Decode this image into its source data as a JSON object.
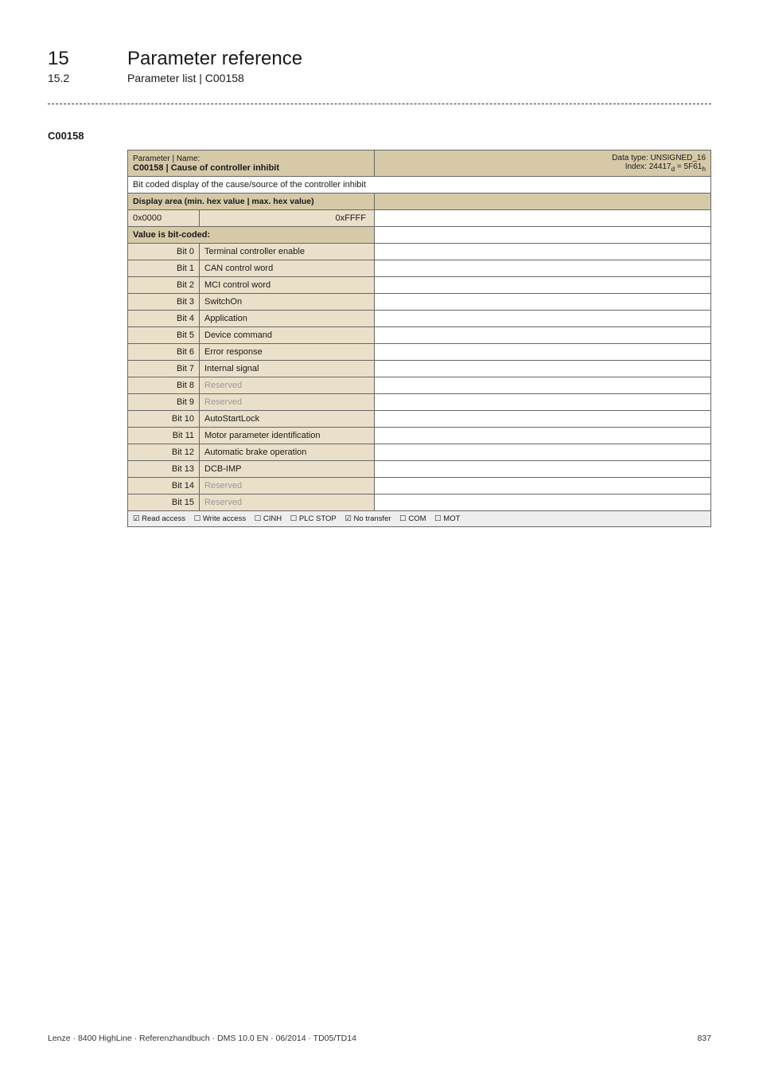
{
  "chapter": {
    "num": "15",
    "title": "Parameter reference"
  },
  "sub": {
    "num": "15.2",
    "title": "Parameter list | C00158"
  },
  "param_code": "C00158",
  "table": {
    "header": {
      "pname_label": "Parameter | Name:",
      "pname_main": "C00158 | Cause of controller inhibit",
      "dtype1": "Data type: UNSIGNED_16",
      "dtype2": "Index: 24417d = 5F61h"
    },
    "desc": "Bit coded display of the cause/source of the controller inhibit",
    "display_area_label": "Display area (min. hex value | max. hex value)",
    "hex_min": "0x0000",
    "hex_max": "0xFFFF",
    "bitcoded_label": "Value is bit-coded:",
    "bits": [
      {
        "label": "Bit 0",
        "desc": "Terminal controller enable",
        "reserved": false
      },
      {
        "label": "Bit 1",
        "desc": "CAN control word",
        "reserved": false
      },
      {
        "label": "Bit 2",
        "desc": "MCI control word",
        "reserved": false
      },
      {
        "label": "Bit 3",
        "desc": "SwitchOn",
        "reserved": false
      },
      {
        "label": "Bit 4",
        "desc": "Application",
        "reserved": false
      },
      {
        "label": "Bit 5",
        "desc": "Device command",
        "reserved": false
      },
      {
        "label": "Bit 6",
        "desc": "Error response",
        "reserved": false
      },
      {
        "label": "Bit 7",
        "desc": "Internal signal",
        "reserved": false
      },
      {
        "label": "Bit 8",
        "desc": "Reserved",
        "reserved": true
      },
      {
        "label": "Bit 9",
        "desc": "Reserved",
        "reserved": true
      },
      {
        "label": "Bit 10",
        "desc": "AutoStartLock",
        "reserved": false
      },
      {
        "label": "Bit 11",
        "desc": "Motor parameter identification",
        "reserved": false
      },
      {
        "label": "Bit 12",
        "desc": "Automatic brake operation",
        "reserved": false
      },
      {
        "label": "Bit 13",
        "desc": "DCB-IMP",
        "reserved": false
      },
      {
        "label": "Bit 14",
        "desc": "Reserved",
        "reserved": true
      },
      {
        "label": "Bit 15",
        "desc": "Reserved",
        "reserved": true
      }
    ],
    "access": {
      "read": "☑ Read access",
      "write": "☐ Write access",
      "cinh": "☐ CINH",
      "plc": "☐ PLC STOP",
      "notransfer": "☑ No transfer",
      "com": "☐ COM",
      "mot": "☐ MOT"
    }
  },
  "footer": {
    "left": "Lenze · 8400 HighLine · Referenzhandbuch · DMS 10.0 EN · 06/2014 · TD05/TD14",
    "right": "837"
  }
}
